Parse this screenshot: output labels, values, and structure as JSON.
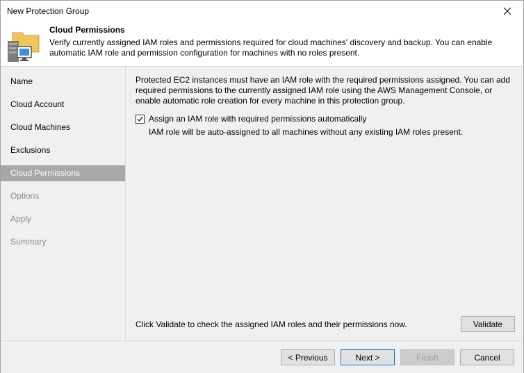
{
  "window": {
    "title": "New Protection Group",
    "close_icon": "close-icon"
  },
  "header": {
    "title": "Cloud Permissions",
    "description": "Verify currently assigned IAM roles and permissions required for cloud machines' discovery and backup. You can enable automatic IAM role and permission configuration for machines with no roles present.",
    "icon": "protection-group-icon"
  },
  "sidebar": {
    "items": [
      {
        "label": "Name",
        "state": "normal"
      },
      {
        "label": "Cloud Account",
        "state": "normal"
      },
      {
        "label": "Cloud Machines",
        "state": "normal"
      },
      {
        "label": "Exclusions",
        "state": "normal"
      },
      {
        "label": "Cloud Permissions",
        "state": "active"
      },
      {
        "label": "Options",
        "state": "disabled"
      },
      {
        "label": "Apply",
        "state": "disabled"
      },
      {
        "label": "Summary",
        "state": "disabled"
      }
    ]
  },
  "content": {
    "intro": "Protected EC2 instances must have an IAM role with the required permissions assigned. You can add required permissions to the currently assigned IAM role using the AWS Management Console, or enable automatic role creation for every machine in this protection group.",
    "checkbox_label": "Assign an IAM role with required permissions automatically",
    "checkbox_checked": true,
    "checkbox_note": "IAM role will be auto-assigned to all machines without any existing IAM roles present.",
    "validate_text": "Click Validate to check the assigned IAM roles and their permissions now.",
    "validate_label": "Validate"
  },
  "footer": {
    "previous_label": "< Previous",
    "next_label": "Next >",
    "finish_label": "Finish",
    "cancel_label": "Cancel"
  }
}
